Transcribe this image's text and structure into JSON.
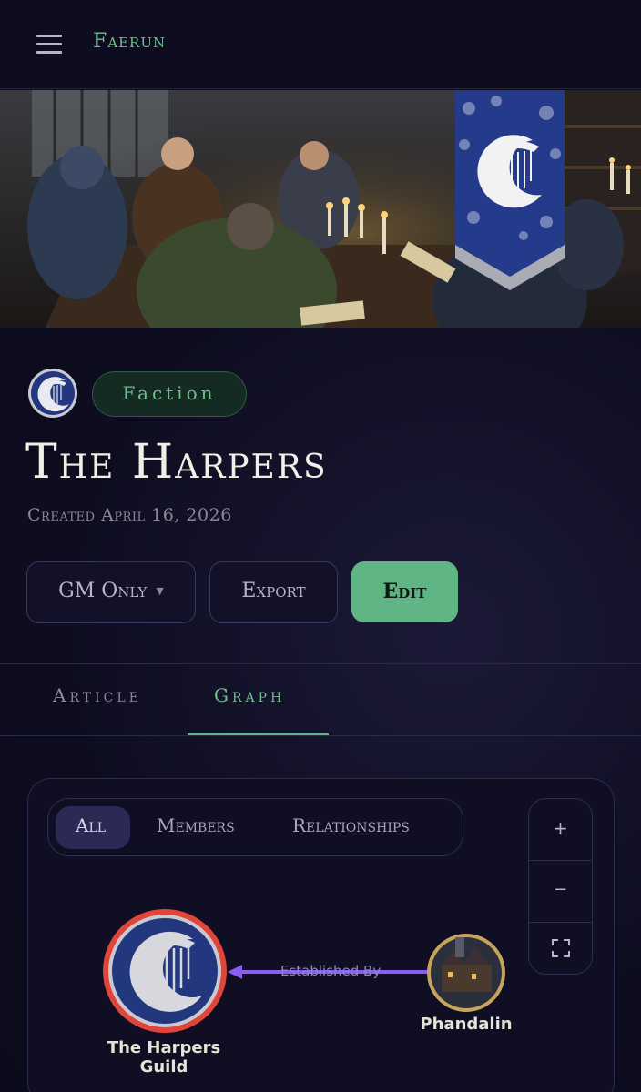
{
  "app": {
    "title": "Faerun"
  },
  "header": {
    "menu_icon": "hamburger-menu-icon"
  },
  "entity": {
    "type_badge": "Faction",
    "title": "The Harpers",
    "created": "Created April 16, 2026",
    "emblem_icon": "harp-crescent-emblem-icon"
  },
  "actions": {
    "visibility_label": "GM Only",
    "export_label": "Export",
    "edit_label": "Edit"
  },
  "tabs": [
    {
      "label": "Article",
      "active": false
    },
    {
      "label": "Graph",
      "active": true
    }
  ],
  "graph": {
    "filters": [
      {
        "label": "All",
        "active": true
      },
      {
        "label": "Members",
        "active": false
      },
      {
        "label": "Relationships",
        "active": false
      }
    ],
    "zoom": {
      "in_label": "+",
      "out_label": "−",
      "fit_icon": "fit-screen-icon"
    },
    "nodes": [
      {
        "label": "The Harpers Guild",
        "line1": "The Harpers",
        "line2": "Guild",
        "ring_color": "#e0443b"
      },
      {
        "label": "Phandalin",
        "ring_color": "#c8a45a"
      }
    ],
    "edge": {
      "label": "Established By",
      "color": "#8b5cf6"
    }
  },
  "colors": {
    "accent": "#5fb583",
    "background": "#0d0c1d",
    "banner_blue": "#243a8a"
  }
}
